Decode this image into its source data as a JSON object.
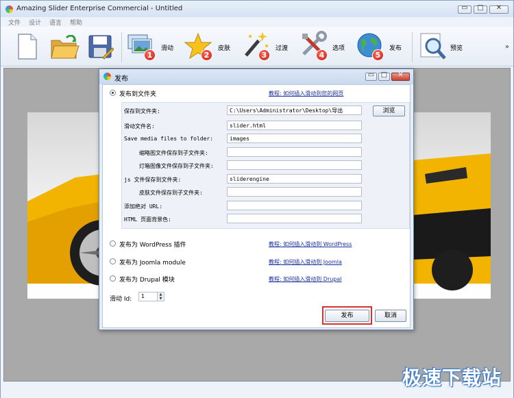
{
  "window": {
    "title": "Amazing Slider Enterprise Commercial - Untitled"
  },
  "window_buttons": {
    "minimize": "▭",
    "maximize": "□",
    "close": "✕"
  },
  "menu": [
    "文件",
    "设计",
    "语言",
    "帮助"
  ],
  "toolbar": {
    "items": [
      {
        "icon": "new-file-icon",
        "label": ""
      },
      {
        "icon": "open-folder-icon",
        "label": ""
      },
      {
        "icon": "save-disk-icon",
        "label": ""
      },
      {
        "icon": "slides-icon",
        "label": "滑动",
        "badge": "1"
      },
      {
        "icon": "skin-star-icon",
        "label": "皮肤",
        "badge": "2"
      },
      {
        "icon": "transition-wand-icon",
        "label": "过渡",
        "badge": "3"
      },
      {
        "icon": "options-tools-icon",
        "label": "选项",
        "badge": "4"
      },
      {
        "icon": "publish-globe-icon",
        "label": "发布",
        "badge": "5"
      },
      {
        "icon": "preview-magnifier-icon",
        "label": "预览"
      }
    ],
    "more": "»"
  },
  "dialog": {
    "title": "发布",
    "publish_folder": {
      "label": "发布到文件夹",
      "selected": true,
      "help_link": "教程: 如何插入滑动到您的网页",
      "fields": [
        {
          "label": "保存到文件夹:",
          "value": "C:\\Users\\Administrator\\Desktop\\导出"
        },
        {
          "label": "滑动文件名:",
          "value": "slider.html"
        },
        {
          "label": "Save media files to folder:",
          "value": "images"
        },
        {
          "label": "缩略图文件保存到子文件夹:",
          "value": ""
        },
        {
          "label": "灯箱图像文件保存到子文件夹:",
          "value": ""
        },
        {
          "label": "js 文件保存到文件夹:",
          "value": "sliderengine"
        },
        {
          "label": "皮肤文件保存到子文件夹:",
          "value": ""
        },
        {
          "label": "添加绝对 URL:",
          "value": ""
        },
        {
          "label": "HTML 页面背景色:",
          "value": ""
        }
      ],
      "browse_button": "浏览"
    },
    "options": [
      {
        "label": "发布为 WordPress 插件",
        "link": "教程: 如何插入滑动到 WordPress"
      },
      {
        "label": "发布为 Joomla module",
        "link": "教程: 如何插入滑动到 Joomla"
      },
      {
        "label": "发布为 Drupal 模块",
        "link": "教程: 如何插入滑动到 Drupal"
      }
    ],
    "slider_id": {
      "label": "滑动 Id:",
      "value": "1"
    },
    "publish_button": "发布",
    "cancel_button": "取消"
  },
  "watermark": "极速下载站",
  "colors": {
    "highlight": "#d8302a",
    "link": "#1a2f9e",
    "badge": "#d42418"
  }
}
